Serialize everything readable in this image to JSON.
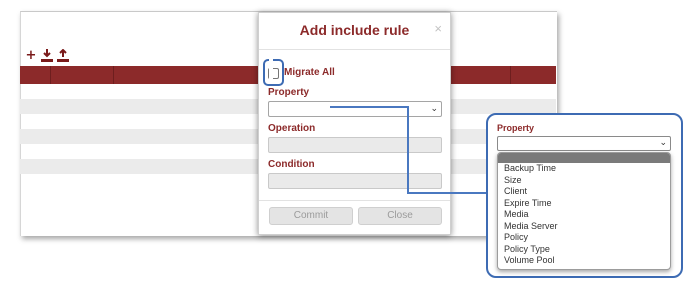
{
  "toolbar": {
    "add_icon": "plus-icon",
    "download_icon": "download-icon",
    "upload_icon": "upload-icon"
  },
  "modal": {
    "title": "Add include rule",
    "close": "×",
    "migrate_all_label": "Migrate All",
    "property_label": "Property",
    "operation_label": "Operation",
    "condition_label": "Condition",
    "commit_label": "Commit",
    "close_label": "Close"
  },
  "zoom": {
    "property_label": "Property",
    "options": [
      "Backup Time",
      "Size",
      "Client",
      "Expire Time",
      "Media",
      "Media Server",
      "Policy",
      "Policy Type",
      "Volume Pool"
    ]
  },
  "colors": {
    "accent": "#8c2a2a",
    "callout": "#3d6bb3"
  }
}
